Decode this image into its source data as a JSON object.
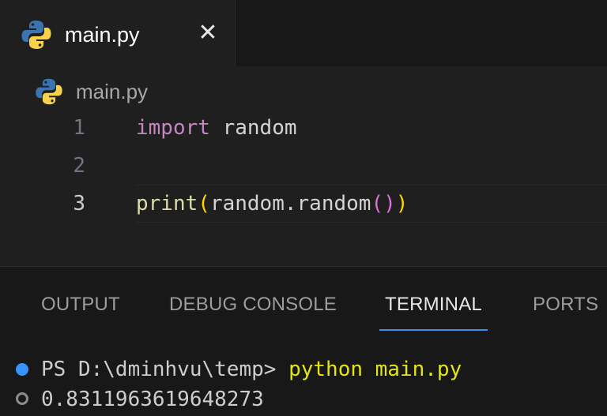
{
  "editor_tab": {
    "label": "main.py",
    "close_glyph": "✕",
    "icon": "python-icon"
  },
  "breadcrumb": {
    "label": "main.py",
    "icon": "python-icon"
  },
  "code": {
    "line_numbers": [
      "1",
      "2",
      "3"
    ],
    "line1": {
      "keyword": "import",
      "module": "random"
    },
    "line3": {
      "fn": "print",
      "open_paren": "(",
      "obj": "random.random",
      "inner_parens": "()",
      "close_paren": ")"
    }
  },
  "panel": {
    "tabs": [
      "OUTPUT",
      "DEBUG CONSOLE",
      "TERMINAL",
      "PORTS"
    ],
    "active_tab": "TERMINAL"
  },
  "terminal": {
    "prompt": "PS D:\\dminhvu\\temp>",
    "command": "python main.py",
    "output": "0.8311963619648273"
  },
  "colors": {
    "keyword": "#c586c0",
    "function": "#dcdcaa",
    "bracket_level1": "#ffd700",
    "bracket_level2": "#da70d6",
    "terminal_command": "#e5e510",
    "active_tab_underline": "#3b8eea"
  }
}
